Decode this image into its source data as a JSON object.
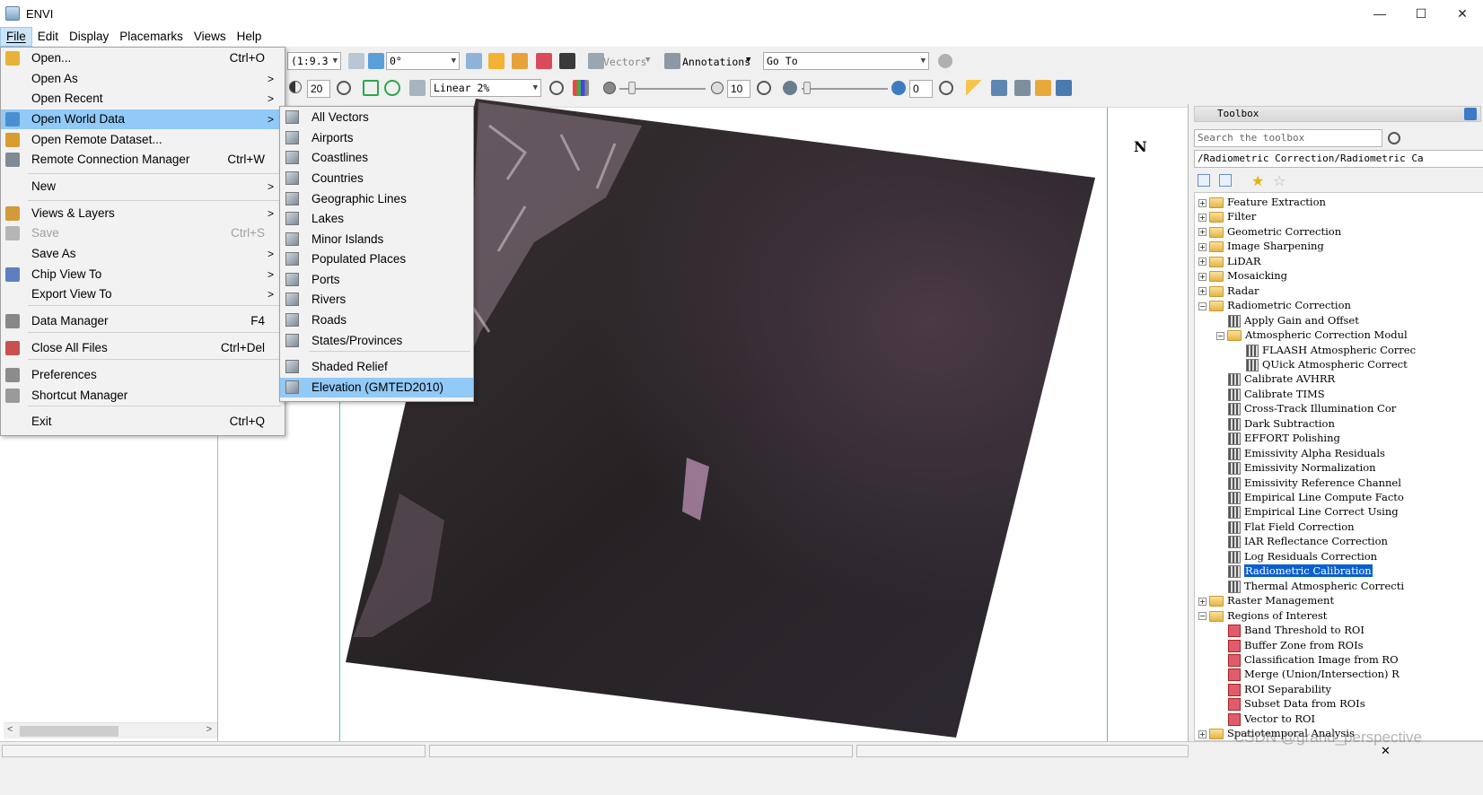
{
  "window": {
    "title": "ENVI",
    "controls": [
      "—",
      "☐",
      "✕"
    ]
  },
  "menubar": [
    "File",
    "Edit",
    "Display",
    "Placemarks",
    "Views",
    "Help"
  ],
  "toolbar": {
    "scale_combo": "(1:9.3",
    "rotation_combo": "0°",
    "vectors_label": "Vectors",
    "annotations_label": "Annotations",
    "goto_combo": "Go To",
    "sharpen_value": "20",
    "stretch_combo": "Linear 2%",
    "brightness_value": "10",
    "transparency_value": "0"
  },
  "file_menu": {
    "items": [
      {
        "label": "Open...",
        "shortcut": "Ctrl+O",
        "arrow": "",
        "icon": "open-folder-icon",
        "enabled": true
      },
      {
        "label": "Open As",
        "shortcut": "",
        "arrow": ">",
        "icon": "",
        "enabled": true
      },
      {
        "label": "Open Recent",
        "shortcut": "",
        "arrow": ">",
        "icon": "",
        "enabled": true
      },
      {
        "label": "Open World Data",
        "shortcut": "",
        "arrow": ">",
        "icon": "world-data-icon",
        "enabled": true,
        "highlighted": true
      },
      {
        "label": "Open Remote Dataset...",
        "shortcut": "",
        "arrow": "",
        "icon": "remote-dataset-icon",
        "enabled": true
      },
      {
        "label": "Remote Connection Manager",
        "shortcut": "Ctrl+W",
        "arrow": "",
        "icon": "connection-icon",
        "enabled": true
      },
      {
        "label": "New",
        "shortcut": "",
        "arrow": ">",
        "icon": "",
        "enabled": true
      },
      {
        "label": "Views & Layers",
        "shortcut": "",
        "arrow": ">",
        "icon": "layers-icon",
        "enabled": true
      },
      {
        "label": "Save",
        "shortcut": "Ctrl+S",
        "arrow": "",
        "icon": "save-icon",
        "enabled": false
      },
      {
        "label": "Save As",
        "shortcut": "",
        "arrow": ">",
        "icon": "",
        "enabled": true
      },
      {
        "label": "Chip View To",
        "shortcut": "",
        "arrow": ">",
        "icon": "chip-icon",
        "enabled": true
      },
      {
        "label": "Export View To",
        "shortcut": "",
        "arrow": ">",
        "icon": "",
        "enabled": true
      },
      {
        "label": "Data Manager",
        "shortcut": "F4",
        "arrow": "",
        "icon": "data-manager-icon",
        "enabled": true
      },
      {
        "label": "Close All Files",
        "shortcut": "Ctrl+Del",
        "arrow": "",
        "icon": "close-files-icon",
        "enabled": true
      },
      {
        "label": "Preferences",
        "shortcut": "",
        "arrow": "",
        "icon": "wrench-icon",
        "enabled": true
      },
      {
        "label": "Shortcut Manager",
        "shortcut": "",
        "arrow": "",
        "icon": "keyboard-icon",
        "enabled": true
      },
      {
        "label": "Exit",
        "shortcut": "Ctrl+Q",
        "arrow": "",
        "icon": "",
        "enabled": true
      }
    ]
  },
  "world_data_submenu": {
    "items": [
      "All Vectors",
      "Airports",
      "Coastlines",
      "Countries",
      "Geographic Lines",
      "Lakes",
      "Minor Islands",
      "Populated Places",
      "Ports",
      "Rivers",
      "Roads",
      "States/Provinces",
      "Shaded Relief",
      "Elevation (GMTED2010)"
    ],
    "highlighted": "Elevation (GMTED2010)"
  },
  "view": {
    "north_label": "N"
  },
  "toolbox": {
    "title": "Toolbox",
    "search_placeholder": "Search the toolbox",
    "path": "/Radiometric Correction/Radiometric Ca",
    "tree": [
      {
        "label": "Feature Extraction",
        "level": 0,
        "kind": "folder",
        "exp": "+"
      },
      {
        "label": "Filter",
        "level": 0,
        "kind": "folder",
        "exp": "+"
      },
      {
        "label": "Geometric Correction",
        "level": 0,
        "kind": "folder",
        "exp": "+"
      },
      {
        "label": "Image Sharpening",
        "level": 0,
        "kind": "folder",
        "exp": "+"
      },
      {
        "label": "LiDAR",
        "level": 0,
        "kind": "folder",
        "exp": "+"
      },
      {
        "label": "Mosaicking",
        "level": 0,
        "kind": "folder",
        "exp": "+"
      },
      {
        "label": "Radar",
        "level": 0,
        "kind": "folder",
        "exp": "+"
      },
      {
        "label": "Radiometric Correction",
        "level": 0,
        "kind": "folder",
        "exp": "−"
      },
      {
        "label": "Apply Gain and Offset",
        "level": 1,
        "kind": "tool"
      },
      {
        "label": "Atmospheric Correction Modul",
        "level": 1,
        "kind": "folder",
        "exp": "−"
      },
      {
        "label": "FLAASH Atmospheric Correc",
        "level": 2,
        "kind": "tool"
      },
      {
        "label": "QUick Atmospheric Correct",
        "level": 2,
        "kind": "tool"
      },
      {
        "label": "Calibrate AVHRR",
        "level": 1,
        "kind": "tool"
      },
      {
        "label": "Calibrate TIMS",
        "level": 1,
        "kind": "tool"
      },
      {
        "label": "Cross-Track Illumination Cor",
        "level": 1,
        "kind": "tool"
      },
      {
        "label": "Dark Subtraction",
        "level": 1,
        "kind": "tool"
      },
      {
        "label": "EFFORT Polishing",
        "level": 1,
        "kind": "tool"
      },
      {
        "label": "Emissivity Alpha Residuals",
        "level": 1,
        "kind": "tool"
      },
      {
        "label": "Emissivity Normalization",
        "level": 1,
        "kind": "tool"
      },
      {
        "label": "Emissivity Reference Channel",
        "level": 1,
        "kind": "tool"
      },
      {
        "label": "Empirical Line Compute Facto",
        "level": 1,
        "kind": "tool"
      },
      {
        "label": "Empirical Line Correct Using",
        "level": 1,
        "kind": "tool"
      },
      {
        "label": "Flat Field Correction",
        "level": 1,
        "kind": "tool"
      },
      {
        "label": "IAR Reflectance Correction",
        "level": 1,
        "kind": "tool"
      },
      {
        "label": "Log Residuals Correction",
        "level": 1,
        "kind": "tool"
      },
      {
        "label": "Radiometric Calibration",
        "level": 1,
        "kind": "tool",
        "selected": true
      },
      {
        "label": "Thermal Atmospheric Correcti",
        "level": 1,
        "kind": "tool"
      },
      {
        "label": "Raster Management",
        "level": 0,
        "kind": "folder",
        "exp": "+"
      },
      {
        "label": "Regions of Interest",
        "level": 0,
        "kind": "folder",
        "exp": "−"
      },
      {
        "label": "Band Threshold to ROI",
        "level": 1,
        "kind": "roi"
      },
      {
        "label": "Buffer Zone from ROIs",
        "level": 1,
        "kind": "roi"
      },
      {
        "label": "Classification Image from RO",
        "level": 1,
        "kind": "roi"
      },
      {
        "label": "Merge (Union/Intersection) R",
        "level": 1,
        "kind": "roi"
      },
      {
        "label": "ROI Separability",
        "level": 1,
        "kind": "roi"
      },
      {
        "label": "Subset Data from ROIs",
        "level": 1,
        "kind": "roi"
      },
      {
        "label": "Vector to ROI",
        "level": 1,
        "kind": "roi"
      },
      {
        "label": "Spatiotemporal Analysis",
        "level": 0,
        "kind": "folder",
        "exp": "+"
      }
    ]
  },
  "watermark": "CSDN @grand_perspective",
  "colors": {
    "menu_highlight": "#91c9f7",
    "tree_selection": "#0a5fd0",
    "view_border": "#3fc6c6"
  }
}
